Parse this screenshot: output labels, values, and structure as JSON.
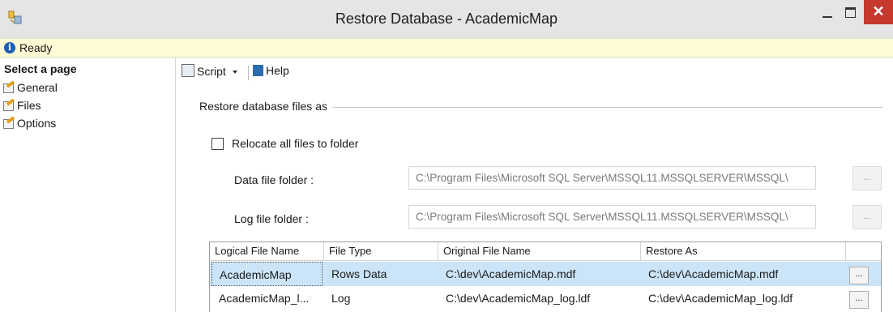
{
  "window": {
    "title": "Restore Database - AcademicMap",
    "close_glyph": "✕"
  },
  "status": {
    "text": "Ready",
    "icon": "info-icon"
  },
  "left_pane": {
    "header": "Select a page",
    "items": [
      {
        "label": "General",
        "icon": "page-icon"
      },
      {
        "label": "Files",
        "icon": "page-icon"
      },
      {
        "label": "Options",
        "icon": "page-icon"
      }
    ]
  },
  "toolbar": {
    "script_label": "Script",
    "help_label": "Help"
  },
  "files": {
    "group_title": "Restore database files as",
    "relocate_label": "Relocate all files to folder",
    "relocate_checked": false,
    "data_folder_label": "Data file folder :",
    "data_folder_value": "C:\\Program Files\\Microsoft SQL Server\\MSSQL11.MSSQLSERVER\\MSSQL\\",
    "log_folder_label": "Log file folder :",
    "log_folder_value": "C:\\Program Files\\Microsoft SQL Server\\MSSQL11.MSSQLSERVER\\MSSQL\\",
    "browse_label": "...",
    "grid": {
      "columns": [
        "Logical File Name",
        "File Type",
        "Original File Name",
        "Restore As"
      ],
      "rows": [
        {
          "logical": "AcademicMap",
          "type": "Rows Data",
          "original": "C:\\dev\\AcademicMap.mdf",
          "restore_as": "C:\\dev\\AcademicMap.mdf",
          "selected": true
        },
        {
          "logical": "AcademicMap_l...",
          "type": "Log",
          "original": "C:\\dev\\AcademicMap_log.ldf",
          "restore_as": "C:\\dev\\AcademicMap_log.ldf",
          "selected": false
        }
      ],
      "row_button_label": "..."
    }
  },
  "colors": {
    "status_bg": "#fffbd4",
    "selected_row": "#cce4f7",
    "close_button": "#c7392e"
  }
}
